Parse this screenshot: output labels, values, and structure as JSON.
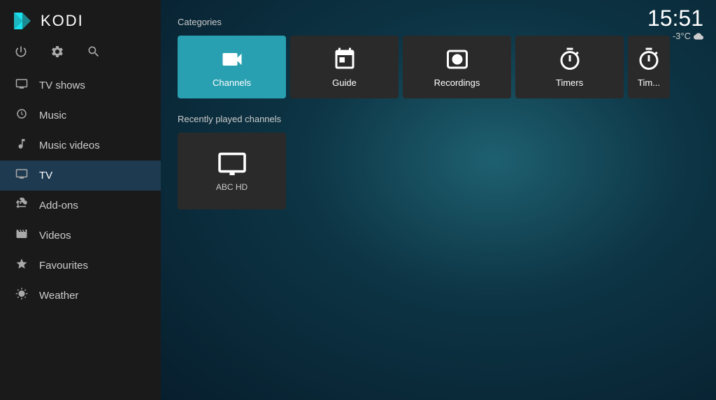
{
  "app": {
    "name": "KODI"
  },
  "clock": {
    "time": "15:51",
    "temperature": "-3°C",
    "weather_icon": "cloud"
  },
  "sidebar": {
    "header_label": "KODI",
    "controls": [
      {
        "id": "power",
        "icon": "⏻",
        "label": "Power"
      },
      {
        "id": "settings",
        "icon": "⚙",
        "label": "Settings"
      },
      {
        "id": "search",
        "icon": "🔍",
        "label": "Search"
      }
    ],
    "nav_items": [
      {
        "id": "tv-shows",
        "label": "TV shows",
        "icon": "tv"
      },
      {
        "id": "music",
        "label": "Music",
        "icon": "headphones"
      },
      {
        "id": "music-videos",
        "label": "Music videos",
        "icon": "music-video"
      },
      {
        "id": "tv",
        "label": "TV",
        "icon": "tv-small",
        "active": true
      },
      {
        "id": "add-ons",
        "label": "Add-ons",
        "icon": "addon"
      },
      {
        "id": "videos",
        "label": "Videos",
        "icon": "film"
      },
      {
        "id": "favourites",
        "label": "Favourites",
        "icon": "star"
      },
      {
        "id": "weather",
        "label": "Weather",
        "icon": "cloud"
      }
    ]
  },
  "main": {
    "categories_label": "Categories",
    "categories": [
      {
        "id": "channels",
        "label": "Channels",
        "active": true
      },
      {
        "id": "guide",
        "label": "Guide",
        "active": false
      },
      {
        "id": "recordings",
        "label": "Recordings",
        "active": false
      },
      {
        "id": "timers",
        "label": "Timers",
        "active": false
      },
      {
        "id": "timers2",
        "label": "Tim...",
        "active": false
      }
    ],
    "recently_played_label": "Recently played channels",
    "channels": [
      {
        "id": "abc-hd",
        "label": "ABC HD"
      }
    ]
  }
}
